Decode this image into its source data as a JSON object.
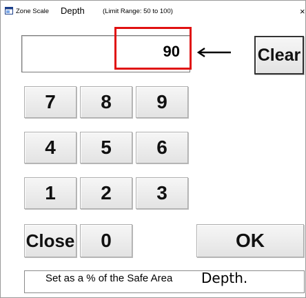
{
  "window": {
    "title": "Zone Scale",
    "title_overlay": "Depth",
    "limit_text": "(Limit Range: 50 to 100)",
    "close_glyph": "×"
  },
  "display": {
    "value": "90",
    "highlight_color": "#e01010"
  },
  "icons": {
    "window_icon": "app-window-icon",
    "backspace": "left-arrow-icon"
  },
  "keypad": {
    "clear": "Clear",
    "k7": "7",
    "k8": "8",
    "k9": "9",
    "k4": "4",
    "k5": "5",
    "k6": "6",
    "k1": "1",
    "k2": "2",
    "k3": "3",
    "close": "Close",
    "k0": "0",
    "ok": "OK"
  },
  "status": {
    "text": "Set as a % of the Safe Area",
    "overlay": "Depth."
  }
}
